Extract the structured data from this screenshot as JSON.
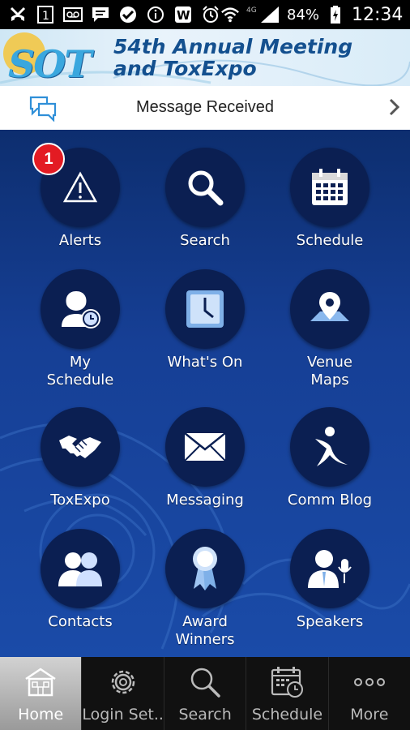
{
  "status_bar": {
    "battery": "84%",
    "time": "12:34",
    "network": "4G"
  },
  "banner": {
    "logo_text": "SOT",
    "title_line1": "54th Annual Meeting",
    "title_line2": "and ToxExpo"
  },
  "message_bar": {
    "text": "Message Received"
  },
  "tiles": [
    {
      "label": "Alerts",
      "icon": "alert-icon",
      "badge": "1"
    },
    {
      "label": "Search",
      "icon": "search-icon"
    },
    {
      "label": "Schedule",
      "icon": "calendar-icon"
    },
    {
      "label": "My\nSchedule",
      "icon": "my-schedule-icon"
    },
    {
      "label": "What's On",
      "icon": "clock-icon"
    },
    {
      "label": "Venue\nMaps",
      "icon": "map-pin-icon"
    },
    {
      "label": "ToxExpo",
      "icon": "handshake-icon"
    },
    {
      "label": "Messaging",
      "icon": "envelope-icon"
    },
    {
      "label": "Comm Blog",
      "icon": "blog-icon"
    },
    {
      "label": "Contacts",
      "icon": "contacts-icon"
    },
    {
      "label": "Award\nWinners",
      "icon": "ribbon-icon"
    },
    {
      "label": "Speakers",
      "icon": "speaker-icon"
    }
  ],
  "tab_bar": [
    {
      "label": "Home",
      "icon": "home-icon",
      "active": true
    },
    {
      "label": "Login Set..",
      "icon": "gear-icon"
    },
    {
      "label": "Search",
      "icon": "search-icon"
    },
    {
      "label": "Schedule",
      "icon": "calendar-clock-icon"
    },
    {
      "label": "More",
      "icon": "more-icon"
    }
  ],
  "colors": {
    "main_bg": "#163f95",
    "circle_bg": "#0b1f52",
    "badge": "#e31b23",
    "banner_text": "#14508f"
  }
}
